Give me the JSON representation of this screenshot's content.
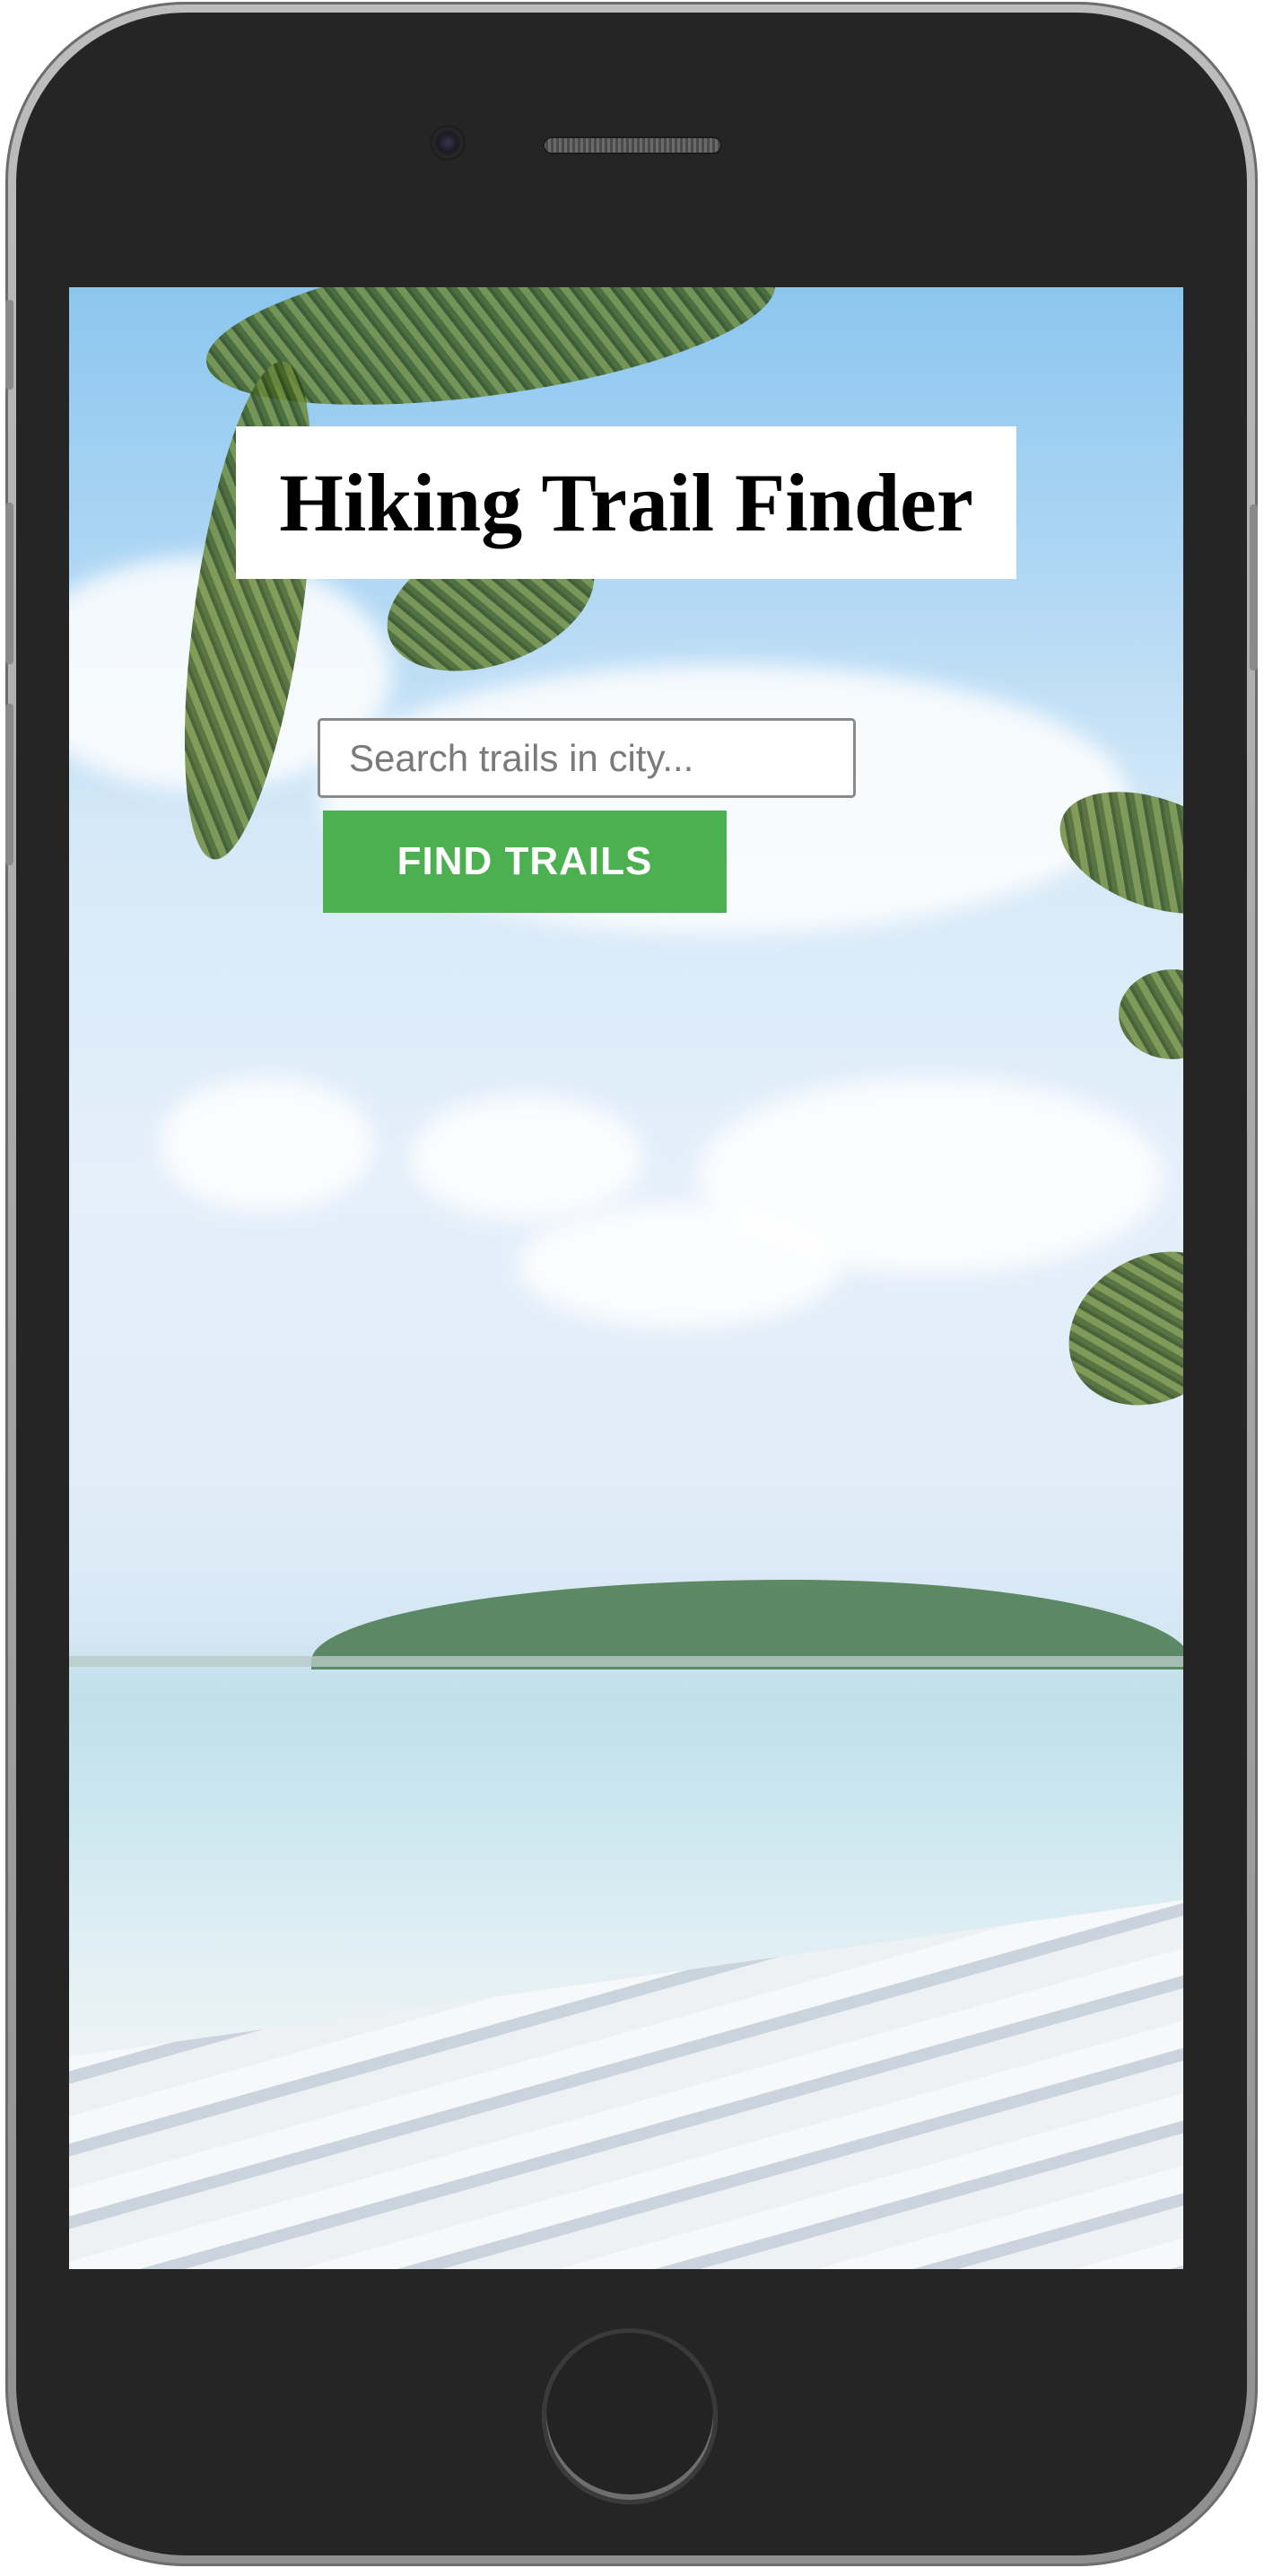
{
  "app": {
    "title": "Hiking Trail Finder"
  },
  "search": {
    "placeholder": "Search trails in city...",
    "value": ""
  },
  "actions": {
    "find_label": "FIND TRAILS"
  },
  "colors": {
    "button_bg": "#4caf50",
    "button_text": "#ffffff",
    "title_bg": "#ffffff",
    "device_body": "#252525"
  },
  "icons": {
    "camera": "camera-icon",
    "speaker": "speaker-grille-icon",
    "home": "home-button-icon"
  }
}
